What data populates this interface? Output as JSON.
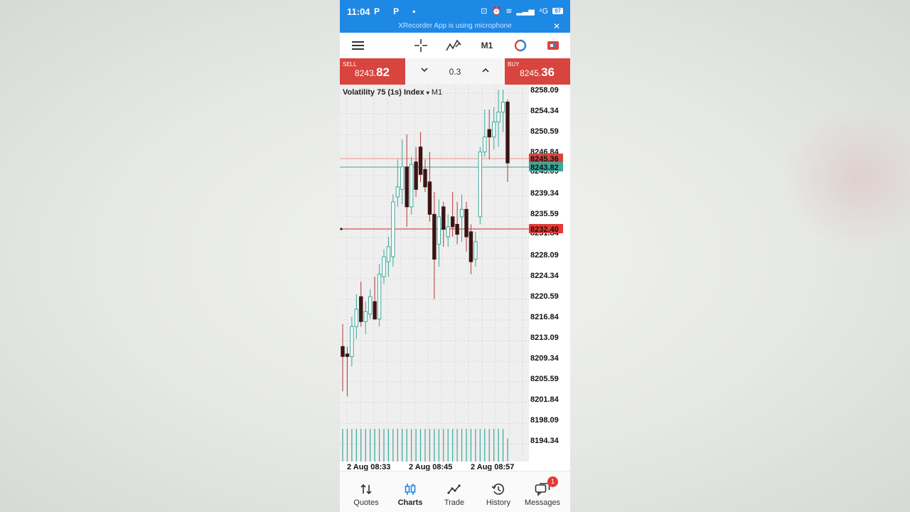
{
  "status_bar": {
    "time": "11:04",
    "left_icons": "P P",
    "battery": "97",
    "network": "⁴G",
    "notice": "XRecorder App is using microphone",
    "close": "✕"
  },
  "toolbar": {
    "timeframe": "M1"
  },
  "trade": {
    "sell_label": "SELL",
    "sell_price_main": "8243.",
    "sell_price_big": "82",
    "volume": "0.3",
    "buy_label": "BUY",
    "buy_price_main": "8245.",
    "buy_price_big": "36"
  },
  "chart": {
    "symbol": "Volatility 75 (1s) Index",
    "symbol_arrow": "▾",
    "timeframe": "M1",
    "colors": {
      "bull": "#3aa89a",
      "bear": "#3a1414",
      "bid_line": "#3aa89a",
      "ask_line": "#d8453f",
      "level_line": "#c62828"
    }
  },
  "chart_data": {
    "type": "candlestick",
    "y_ticks": [
      "8258.09",
      "8254.34",
      "8250.59",
      "8246.84",
      "8239.34",
      "8235.59",
      "8228.09",
      "8224.34",
      "8220.59",
      "8216.84",
      "8213.09",
      "8209.34",
      "8205.59",
      "8201.84",
      "8198.09",
      "8194.34"
    ],
    "price_tags": {
      "ask": "8245.36",
      "bid": "8243.82",
      "level": "8232.40",
      "hidden_ticks": [
        "8243.09",
        "8231.84"
      ]
    },
    "x_ticks": [
      "2 Aug 08:33",
      "2 Aug 08:45",
      "2 Aug 08:57"
    ],
    "ylim": [
      8192.5,
      8259.5
    ],
    "candles": [
      {
        "o": 8207.0,
        "h": 8211.5,
        "l": 8198.0,
        "c": 8205.0
      },
      {
        "o": 8205.5,
        "h": 8207.0,
        "l": 8197.0,
        "c": 8205.0
      },
      {
        "o": 8205.0,
        "h": 8213.0,
        "l": 8203.0,
        "c": 8211.0
      },
      {
        "o": 8211.0,
        "h": 8217.5,
        "l": 8208.5,
        "c": 8214.5
      },
      {
        "o": 8217.0,
        "h": 8220.0,
        "l": 8211.0,
        "c": 8212.0
      },
      {
        "o": 8212.0,
        "h": 8216.0,
        "l": 8209.5,
        "c": 8214.0
      },
      {
        "o": 8213.5,
        "h": 8218.5,
        "l": 8212.5,
        "c": 8217.0
      },
      {
        "o": 8216.0,
        "h": 8221.0,
        "l": 8214.5,
        "c": 8212.5
      },
      {
        "o": 8212.5,
        "h": 8223.5,
        "l": 8211.0,
        "c": 8221.5
      },
      {
        "o": 8221.0,
        "h": 8226.5,
        "l": 8219.5,
        "c": 8225.0
      },
      {
        "o": 8224.0,
        "h": 8229.0,
        "l": 8221.0,
        "c": 8227.0
      },
      {
        "o": 8225.0,
        "h": 8237.5,
        "l": 8223.0,
        "c": 8236.0
      },
      {
        "o": 8237.0,
        "h": 8244.5,
        "l": 8235.0,
        "c": 8239.0
      },
      {
        "o": 8238.5,
        "h": 8248.5,
        "l": 8235.5,
        "c": 8243.0
      },
      {
        "o": 8243.0,
        "h": 8249.5,
        "l": 8231.0,
        "c": 8235.0
      },
      {
        "o": 8235.0,
        "h": 8245.0,
        "l": 8233.5,
        "c": 8243.5
      },
      {
        "o": 8244.0,
        "h": 8247.0,
        "l": 8237.0,
        "c": 8238.5
      },
      {
        "o": 8247.0,
        "h": 8250.0,
        "l": 8240.0,
        "c": 8241.5
      },
      {
        "o": 8242.5,
        "h": 8244.5,
        "l": 8238.0,
        "c": 8239.0
      },
      {
        "o": 8240.0,
        "h": 8246.0,
        "l": 8232.0,
        "c": 8233.5
      },
      {
        "o": 8233.5,
        "h": 8238.0,
        "l": 8216.5,
        "c": 8224.5
      },
      {
        "o": 8227.5,
        "h": 8236.5,
        "l": 8223.0,
        "c": 8233.0
      },
      {
        "o": 8235.0,
        "h": 8236.0,
        "l": 8227.0,
        "c": 8230.5
      },
      {
        "o": 8229.0,
        "h": 8233.5,
        "l": 8227.0,
        "c": 8231.0
      },
      {
        "o": 8233.0,
        "h": 8238.0,
        "l": 8229.0,
        "c": 8231.0
      },
      {
        "o": 8231.5,
        "h": 8236.0,
        "l": 8227.5,
        "c": 8229.5
      },
      {
        "o": 8233.0,
        "h": 8237.5,
        "l": 8228.0,
        "c": 8234.5
      },
      {
        "o": 8234.5,
        "h": 8236.0,
        "l": 8226.0,
        "c": 8229.0
      },
      {
        "o": 8230.0,
        "h": 8231.5,
        "l": 8221.5,
        "c": 8224.0
      },
      {
        "o": 8224.5,
        "h": 8230.0,
        "l": 8223.0,
        "c": 8228.0
      },
      {
        "o": 8233.0,
        "h": 8247.0,
        "l": 8231.5,
        "c": 8246.0
      },
      {
        "o": 8246.0,
        "h": 8254.5,
        "l": 8245.0,
        "c": 8249.0
      },
      {
        "o": 8250.5,
        "h": 8254.5,
        "l": 8244.5,
        "c": 8249.0
      },
      {
        "o": 8249.0,
        "h": 8255.0,
        "l": 8246.5,
        "c": 8252.0
      },
      {
        "o": 8252.0,
        "h": 8258.5,
        "l": 8247.0,
        "c": 8254.0
      },
      {
        "o": 8254.0,
        "h": 8258.5,
        "l": 8250.0,
        "c": 8256.0
      },
      {
        "o": 8256.0,
        "h": 8256.5,
        "l": 8240.0,
        "c": 8243.8
      }
    ],
    "volumes": [
      0.85,
      0.85,
      0.85,
      0.85,
      0.85,
      0.85,
      0.85,
      0.85,
      0.85,
      0.85,
      0.85,
      0.85,
      0.85,
      0.85,
      0.85,
      0.85,
      0.85,
      0.85,
      0.85,
      0.85,
      0.85,
      0.85,
      0.85,
      0.85,
      0.85,
      0.85,
      0.85,
      0.85,
      0.85,
      0.85,
      0.85,
      0.85,
      0.85,
      0.85,
      0.85,
      0.85,
      0.6
    ]
  },
  "nav": {
    "items": [
      {
        "label": "Quotes",
        "icon": "quotes-icon"
      },
      {
        "label": "Charts",
        "icon": "charts-icon"
      },
      {
        "label": "Trade",
        "icon": "trade-icon"
      },
      {
        "label": "History",
        "icon": "history-icon"
      },
      {
        "label": "Messages",
        "icon": "messages-icon"
      }
    ],
    "active": "Charts",
    "messages_badge": "1"
  }
}
